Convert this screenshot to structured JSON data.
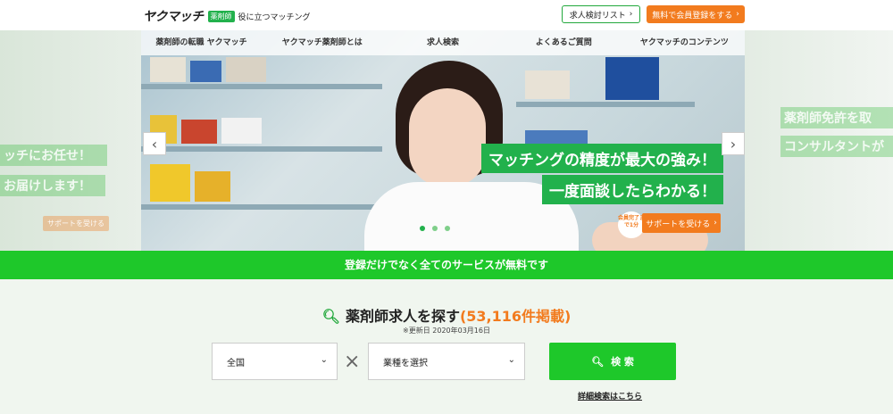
{
  "header": {
    "logo_text": "ヤクマッチ",
    "logo_badge": "薬剤師",
    "logo_tagline": "役に立つマッチング",
    "btn_list": "求人検討リスト",
    "btn_register": "無料で会員登録をする"
  },
  "nav": {
    "items": [
      "薬剤師の転職 ヤクマッチ",
      "ヤクマッチ薬剤師とは",
      "求人検索",
      "よくあるご質問",
      "ヤクマッチのコンテンツ"
    ]
  },
  "hero": {
    "caption1": "マッチングの精度が最大の強み！",
    "caption2": "一度面談したらわかる！",
    "badge": "会員完了まで1分",
    "support_btn": "サポートを受ける",
    "ghost_left_1": "ッチにお任せ！",
    "ghost_left_2": "お届けします！",
    "ghost_left_btn": "サポートを受ける",
    "ghost_right_1": "薬剤師免許を取",
    "ghost_right_2": "コンサルタントが"
  },
  "banner": {
    "text": "登録だけでなく全てのサービスが無料です"
  },
  "search": {
    "title": "薬剤師求人を探す",
    "count": "(53,116件掲載)",
    "updated": "※更新日 2020年03月16日",
    "region_value": "全国",
    "type_value": "業種を選択",
    "search_btn": "検 索",
    "advanced_link": "詳細検索はこちら"
  },
  "colors": {
    "brand_green": "#1ec82a",
    "accent_orange": "#f27b1e"
  }
}
